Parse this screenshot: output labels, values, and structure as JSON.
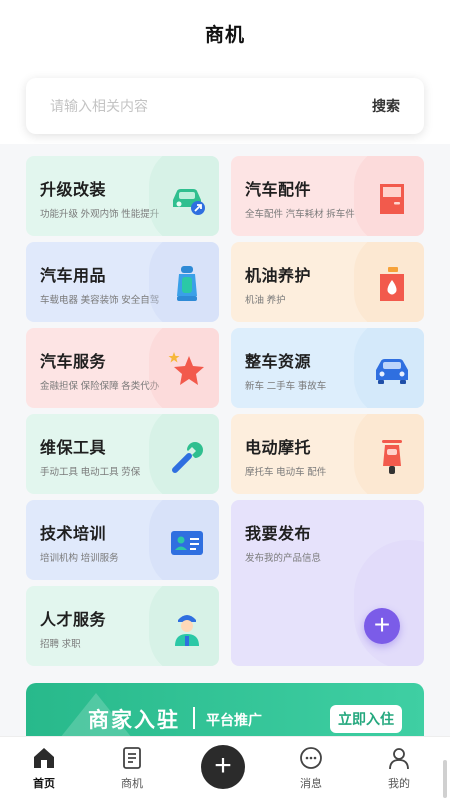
{
  "header": {
    "title": "商机"
  },
  "search": {
    "placeholder": "请输入相关内容",
    "button_label": "搜索"
  },
  "cards": [
    {
      "title": "升级改装",
      "subtitle": "功能升级  外观内饰  性能提升",
      "color": "#e2f6ee",
      "icon": "car-upgrade-icon"
    },
    {
      "title": "汽车配件",
      "subtitle": "全车配件  汽车耗材  拆车件",
      "color": "#fde4e4",
      "icon": "car-door-icon"
    },
    {
      "title": "汽车用品",
      "subtitle": "车载电器  美容装饰  安全自驾",
      "color": "#e0e9fb",
      "icon": "car-seat-icon"
    },
    {
      "title": "机油养护",
      "subtitle": "机油  养护",
      "color": "#fdeedd",
      "icon": "oil-can-icon"
    },
    {
      "title": "汽车服务",
      "subtitle": "金融担保  保险保障  各类代办",
      "color": "#fde4e4",
      "icon": "star-icon"
    },
    {
      "title": "整车资源",
      "subtitle": "新车    二手车    事故车",
      "color": "#ddeefc",
      "icon": "car-front-icon"
    },
    {
      "title": "维保工具",
      "subtitle": "手动工具  电动工具  劳保",
      "color": "#e2f6ee",
      "icon": "wrench-icon"
    },
    {
      "title": "电动摩托",
      "subtitle": "摩托车  电动车  配件",
      "color": "#fdeedd",
      "icon": "scooter-icon"
    },
    {
      "title": "技术培训",
      "subtitle": "培训机构  培训服务",
      "color": "#e0e9fb",
      "icon": "id-card-icon"
    },
    {
      "title": "我要发布",
      "subtitle": "发布我的产品信息",
      "color": "#e6e2fb",
      "icon": "plus-icon"
    },
    {
      "title": "人才服务",
      "subtitle": "招聘  求职",
      "color": "#e2f6ee",
      "icon": "mechanic-icon"
    }
  ],
  "publish_plus": "+",
  "banner": {
    "title": "商家入驻",
    "subtitle": "平台推广",
    "button_label": "立即入住"
  },
  "tabbar": {
    "items": [
      {
        "label": "首页",
        "icon": "home-icon",
        "active": true
      },
      {
        "label": "商机",
        "icon": "document-icon",
        "active": false
      },
      {
        "label": "+",
        "icon": "add-icon",
        "active": false
      },
      {
        "label": "消息",
        "icon": "message-icon",
        "active": false
      },
      {
        "label": "我的",
        "icon": "user-icon",
        "active": false
      }
    ]
  }
}
